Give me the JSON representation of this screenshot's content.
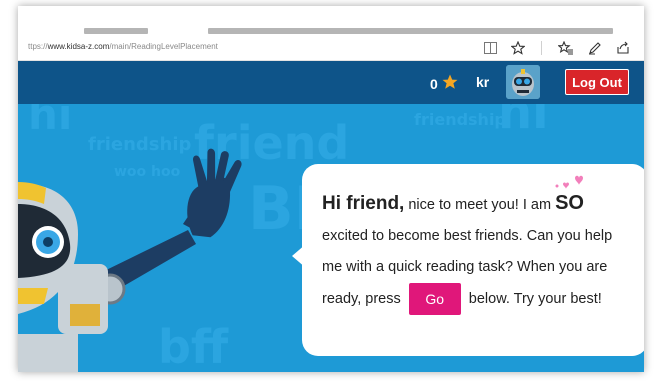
{
  "browser": {
    "url_prefix": "ttps://",
    "url_host": "www.kidsa-z.com",
    "url_path": "/main/ReadingLevelPlacement"
  },
  "header": {
    "star_count": "0",
    "initials": "kr",
    "logout_label": "Log Out"
  },
  "background_words": [
    "friend",
    "friendship",
    "woo hoo",
    "bff",
    "hi",
    "BFFS"
  ],
  "bubble": {
    "greeting": "Hi friend,",
    "text_1": " nice to meet you! I am ",
    "emphasis": "SO",
    "text_2": " excited to become best friends. Can you help me with a quick reading task? When you are ready, press ",
    "go_label": "Go",
    "text_3": " below. Try your best!"
  },
  "colors": {
    "header": "#0e5489",
    "stage": "#1e9ad6",
    "logout": "#d9252a",
    "go_button": "#e0177a",
    "star": "#f5a623"
  }
}
